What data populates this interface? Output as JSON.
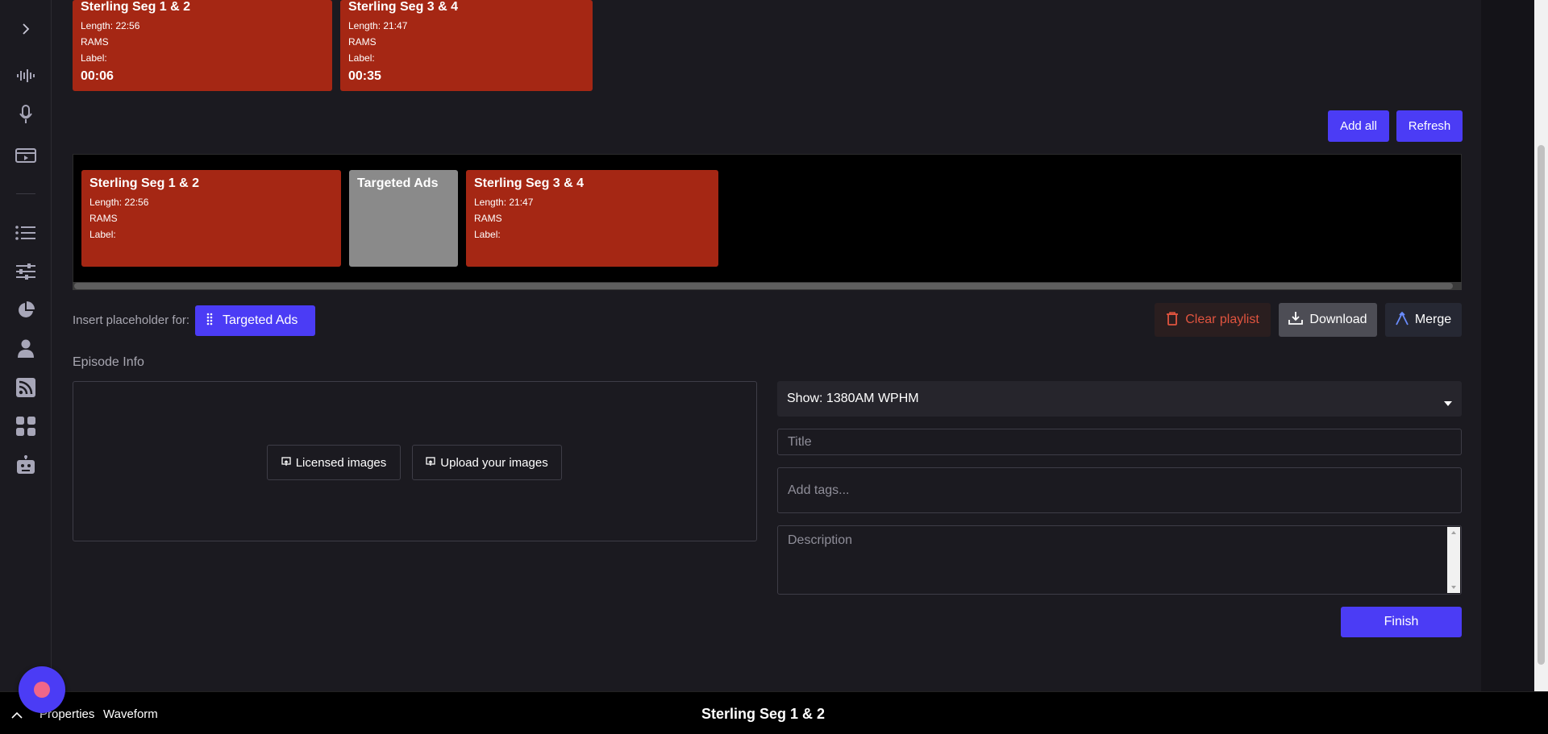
{
  "available_segments": [
    {
      "title": "Sterling Seg 1 & 2",
      "length": "Length: 22:56",
      "source": "RAMS",
      "label": "Label:",
      "time": "00:06"
    },
    {
      "title": "Sterling Seg 3 & 4",
      "length": "Length: 21:47",
      "source": "RAMS",
      "label": "Label:",
      "time": "00:35"
    }
  ],
  "actions": {
    "add_all": "Add all",
    "refresh": "Refresh"
  },
  "playlist": [
    {
      "title": "Sterling Seg 1 & 2",
      "length": "Length: 22:56",
      "source": "RAMS",
      "label": "Label:"
    },
    {
      "title": "Targeted Ads"
    },
    {
      "title": "Sterling Seg 3 & 4",
      "length": "Length: 21:47",
      "source": "RAMS",
      "label": "Label:"
    }
  ],
  "placeholder": {
    "prompt": "Insert placeholder for:",
    "chip": "Targeted Ads"
  },
  "playlist_actions": {
    "clear": "Clear playlist",
    "download": "Download",
    "merge": "Merge"
  },
  "episode": {
    "heading": "Episode Info",
    "licensed_images": "Licensed images",
    "upload_images": "Upload your images",
    "show_select": "Show: 1380AM WPHM",
    "title_placeholder": "Title",
    "tags_placeholder": "Add tags...",
    "description_placeholder": "Description",
    "finish": "Finish"
  },
  "bottom_bar": {
    "properties": "Properties",
    "waveform": "Waveform",
    "now_playing": "Sterling Seg 1 & 2"
  },
  "colors": {
    "accent": "#4b3cf5",
    "segment": "#a52714",
    "placeholder_segment": "#8a8a8a",
    "danger": "#e0543f"
  }
}
